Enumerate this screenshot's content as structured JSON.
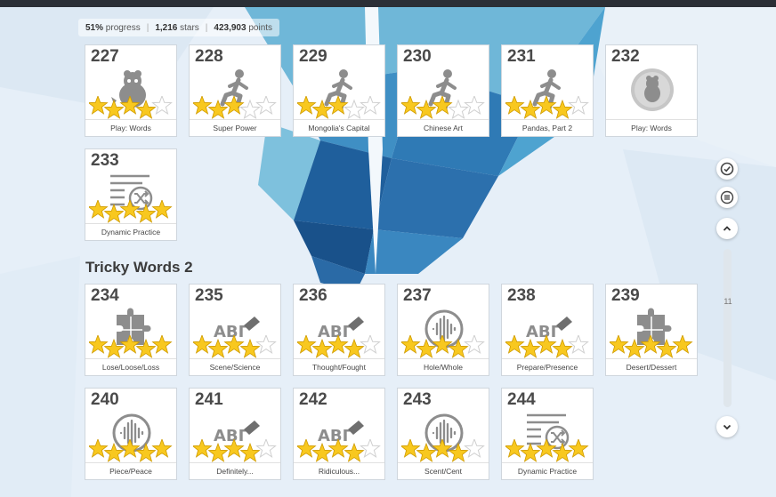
{
  "colors": {
    "star_fill": "#f8c81f",
    "star_stroke": "#cf9b00",
    "icon_gray": "#8d8d8d"
  },
  "stats": {
    "progress_value": "51%",
    "progress_text": "progress",
    "stars_value": "1,216",
    "stars_text": "stars",
    "points_value": "423,903",
    "points_text": "points"
  },
  "section": {
    "title": "Tricky Words 2"
  },
  "rail": {
    "page_number": "11"
  },
  "lessons_top": [
    {
      "number": "227",
      "label": "Play: Words",
      "icon": "creature-icon",
      "stars": 4
    },
    {
      "number": "228",
      "label": "Super Power",
      "icon": "runner-icon",
      "stars": 3
    },
    {
      "number": "229",
      "label": "Mongolia's Capital",
      "icon": "runner-icon",
      "stars": 3
    },
    {
      "number": "230",
      "label": "Chinese Art",
      "icon": "runner-icon",
      "stars": 3
    },
    {
      "number": "231",
      "label": "Pandas, Part 2",
      "icon": "runner-icon",
      "stars": 4
    },
    {
      "number": "232",
      "label": "Play: Words",
      "icon": "locked-creature-icon",
      "stars": 0
    },
    {
      "number": "233",
      "label": "Dynamic Practice",
      "icon": "shuffle-list-icon",
      "stars": 5
    }
  ],
  "lessons_tricky": [
    {
      "number": "234",
      "label": "Lose/Loose/Loss",
      "icon": "puzzle-icon",
      "stars": 5
    },
    {
      "number": "235",
      "label": "Scene/Science",
      "icon": "abc-pencil-icon",
      "stars": 4
    },
    {
      "number": "236",
      "label": "Thought/Fought",
      "icon": "abc-pencil-icon",
      "stars": 4
    },
    {
      "number": "237",
      "label": "Hole/Whole",
      "icon": "audio-wave-icon",
      "stars": 4
    },
    {
      "number": "238",
      "label": "Prepare/Presence",
      "icon": "abc-pencil-icon",
      "stars": 4
    },
    {
      "number": "239",
      "label": "Desert/Dessert",
      "icon": "puzzle-icon",
      "stars": 5
    },
    {
      "number": "240",
      "label": "Piece/Peace",
      "icon": "audio-wave-icon",
      "stars": 5
    },
    {
      "number": "241",
      "label": "Definitely...",
      "icon": "abc-pencil-icon",
      "stars": 4
    },
    {
      "number": "242",
      "label": "Ridiculous...",
      "icon": "abc-pencil-icon",
      "stars": 4
    },
    {
      "number": "243",
      "label": "Scent/Cent",
      "icon": "audio-wave-icon",
      "stars": 4
    },
    {
      "number": "244",
      "label": "Dynamic Practice",
      "icon": "shuffle-list-icon",
      "stars": 5
    }
  ]
}
